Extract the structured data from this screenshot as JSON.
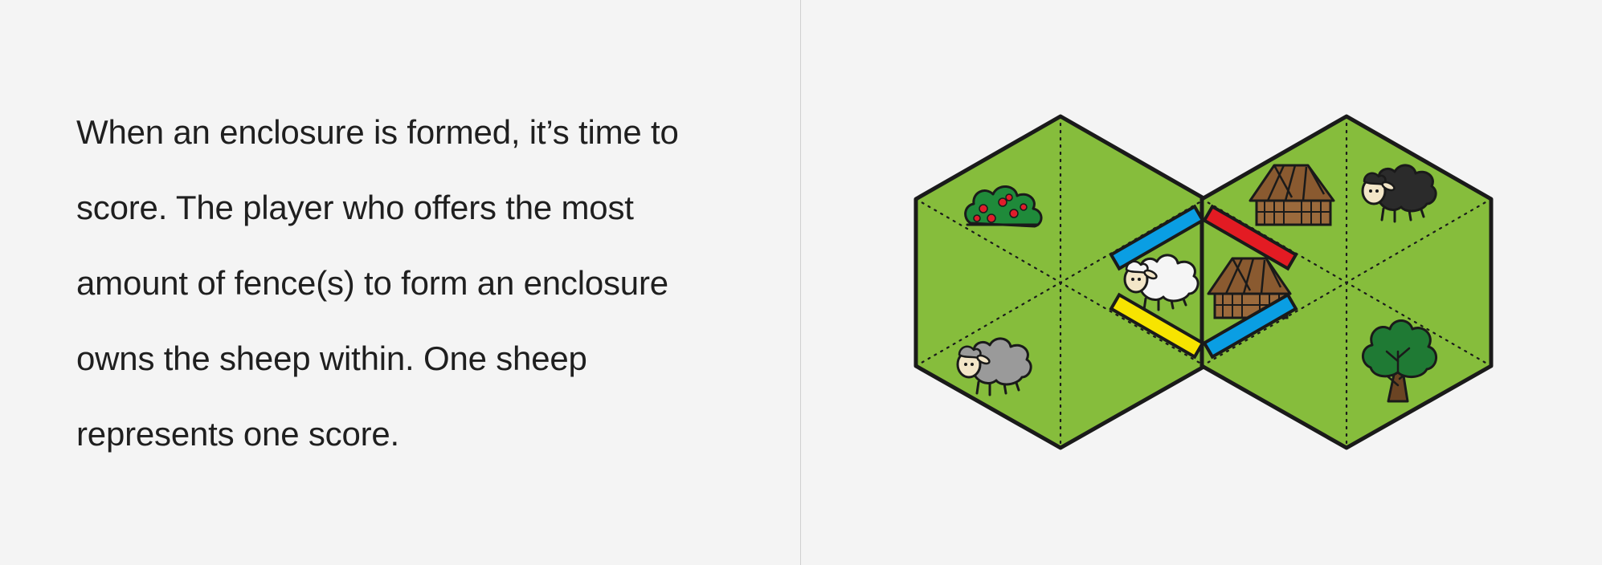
{
  "rules": {
    "lines": [
      "When an enclosure is formed, it’s time to",
      "score. The player who offers the most",
      "amount of fence(s) to form an enclosure",
      "owns the sheep within. One sheep",
      "represents one score."
    ]
  },
  "board": {
    "tiles": [
      {
        "name": "left-hex-tile",
        "pieces": [
          "berry-bush-icon",
          "grey-sheep-icon",
          "white-sheep-icon"
        ]
      },
      {
        "name": "right-hex-tile",
        "pieces": [
          "barn-icon",
          "barn-icon",
          "black-sheep-icon",
          "tree-icon"
        ]
      }
    ],
    "fences": [
      {
        "color": "blue",
        "hex": "#0a9ee3"
      },
      {
        "color": "yellow",
        "hex": "#f7e400"
      },
      {
        "color": "red",
        "hex": "#e31b23"
      },
      {
        "color": "blue",
        "hex": "#0a9ee3"
      }
    ],
    "colors": {
      "grass": "#86bd3c",
      "outline": "#1a1a1a",
      "barn_wall": "#9b6a3c",
      "barn_roof": "#7a4e2b",
      "tree": "#1f7a34",
      "berry": "#e01d2b"
    }
  }
}
